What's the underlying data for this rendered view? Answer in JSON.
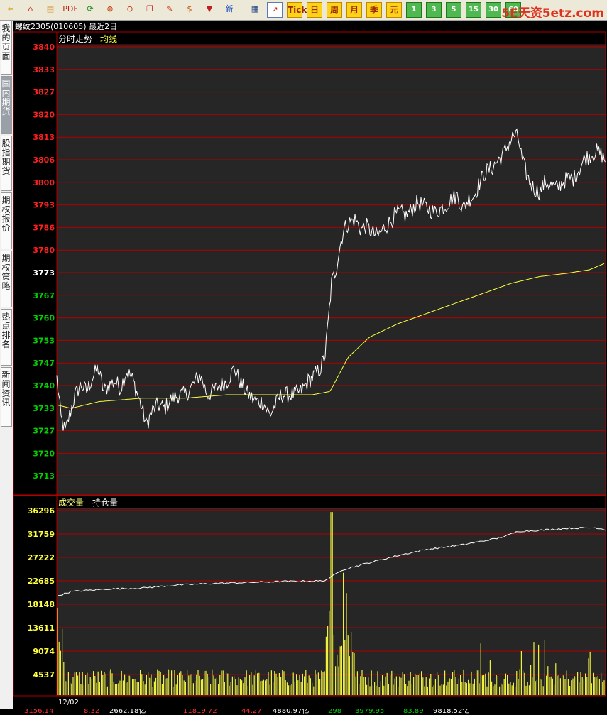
{
  "toolbar": {
    "buttons": [
      {
        "icon": "back-arrow-icon",
        "glyph": "⇦",
        "color": "#d49a00"
      },
      {
        "icon": "home-icon",
        "glyph": "⌂",
        "color": "#c0301e"
      },
      {
        "icon": "book-icon",
        "glyph": "▤",
        "color": "#d48a20"
      },
      {
        "icon": "pdf-icon",
        "glyph": "PDF",
        "color": "#c02010"
      },
      {
        "icon": "refresh-icon",
        "glyph": "⟳",
        "color": "#208820"
      },
      {
        "icon": "zoom-in-icon",
        "glyph": "⊕",
        "color": "#c03000"
      },
      {
        "icon": "zoom-out-icon",
        "glyph": "⊖",
        "color": "#c03000"
      },
      {
        "icon": "window-icon",
        "glyph": "❐",
        "color": "#c02020"
      },
      {
        "icon": "pencil-icon",
        "glyph": "✎",
        "color": "#d02000"
      },
      {
        "icon": "money-bag-icon",
        "glyph": "$",
        "color": "#c05000"
      },
      {
        "icon": "filter-icon",
        "glyph": "▼",
        "color": "#c02020"
      },
      {
        "icon": "news-icon",
        "glyph": "新",
        "color": "#2050c0"
      }
    ],
    "period_buttons": [
      "日",
      "周",
      "月",
      "季",
      "元"
    ],
    "minute_buttons": [
      "1",
      "3",
      "5",
      "15",
      "30",
      "60"
    ],
    "tick_label": "Tick",
    "watermark": "5E天资5etz.com"
  },
  "left_nav": [
    "我的页面",
    "国内期货",
    "股指期货",
    "期权报价",
    "期权策略",
    "热点排名",
    "新闻资讯"
  ],
  "title": {
    "instrument": "螺纹2305",
    "code": "(010605)",
    "range": "最近2日"
  },
  "price_panel": {
    "label": "分时走势",
    "ma_label": "均线",
    "y_labels": [
      "3840",
      "3833",
      "3827",
      "3820",
      "3813",
      "3806",
      "3800",
      "3793",
      "3786",
      "3780",
      "3773",
      "3767",
      "3760",
      "3753",
      "3747",
      "3740",
      "3733",
      "3727",
      "3720",
      "3713"
    ],
    "reference": "3773",
    "colors": {
      "up": "#ff2020",
      "flat": "#ffffff",
      "down": "#00d000",
      "price_line": "#ffffff",
      "ma_line": "#ffff40",
      "grid": "#b00000"
    }
  },
  "volume_panel": {
    "label_volume": "成交量",
    "label_oi": "持仓量",
    "y_labels": [
      "36296",
      "31759",
      "27222",
      "22685",
      "18148",
      "13611",
      "9074",
      "4537"
    ],
    "x_start_label": "12/02",
    "colors": {
      "bars": "#f0f040",
      "oi_line": "#ffffff",
      "axis_text": "#ffff40"
    }
  },
  "status_bar": [
    "3156.14",
    "8.32",
    "2662.18亿",
    "11819.72",
    "44.27",
    "4880.97亿",
    "298",
    "3979.95",
    "83.89",
    "9818.52亿"
  ]
}
